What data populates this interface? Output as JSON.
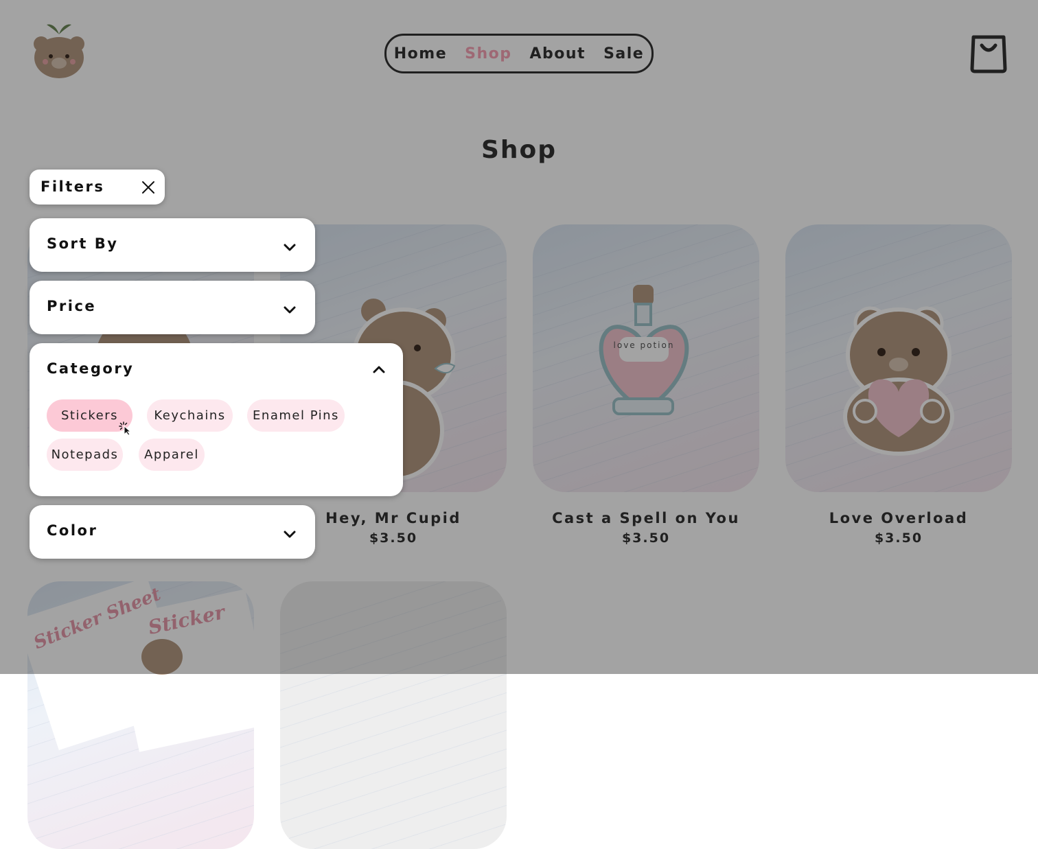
{
  "header": {
    "nav": [
      "Home",
      "Shop",
      "About",
      "Sale"
    ],
    "active_nav": "Shop"
  },
  "page_title": "Shop",
  "products": [
    {
      "name": "Hey, Mr Cupid",
      "price": "$3.50"
    },
    {
      "name": "Cast a Spell on You",
      "price": "$3.50"
    },
    {
      "name": "Love Overload",
      "price": "$3.50"
    }
  ],
  "product_art_text": {
    "potion": "love potion",
    "sheet_1": "Sticker Sheet",
    "sheet_2": "Sticker"
  },
  "filters": {
    "title": "Filters",
    "sort_by": "Sort By",
    "price": "Price",
    "category": {
      "title": "Category",
      "options": [
        "Stickers",
        "Keychains",
        "Enamel Pins",
        "Notepads",
        "Apparel"
      ],
      "selected": "Stickers"
    },
    "color": "Color"
  },
  "colors": {
    "accent_pink": "#f7a3b6",
    "chip_bg": "#fde8ee",
    "chip_selected_bg": "#fcc9d6",
    "text_dark": "#333333",
    "overlay": "rgba(0,0,0,0.36)"
  },
  "icons": [
    "bear-logo-icon",
    "shopping-bag-icon",
    "close-icon",
    "chevron-down-icon",
    "chevron-up-icon",
    "click-cursor-icon"
  ]
}
